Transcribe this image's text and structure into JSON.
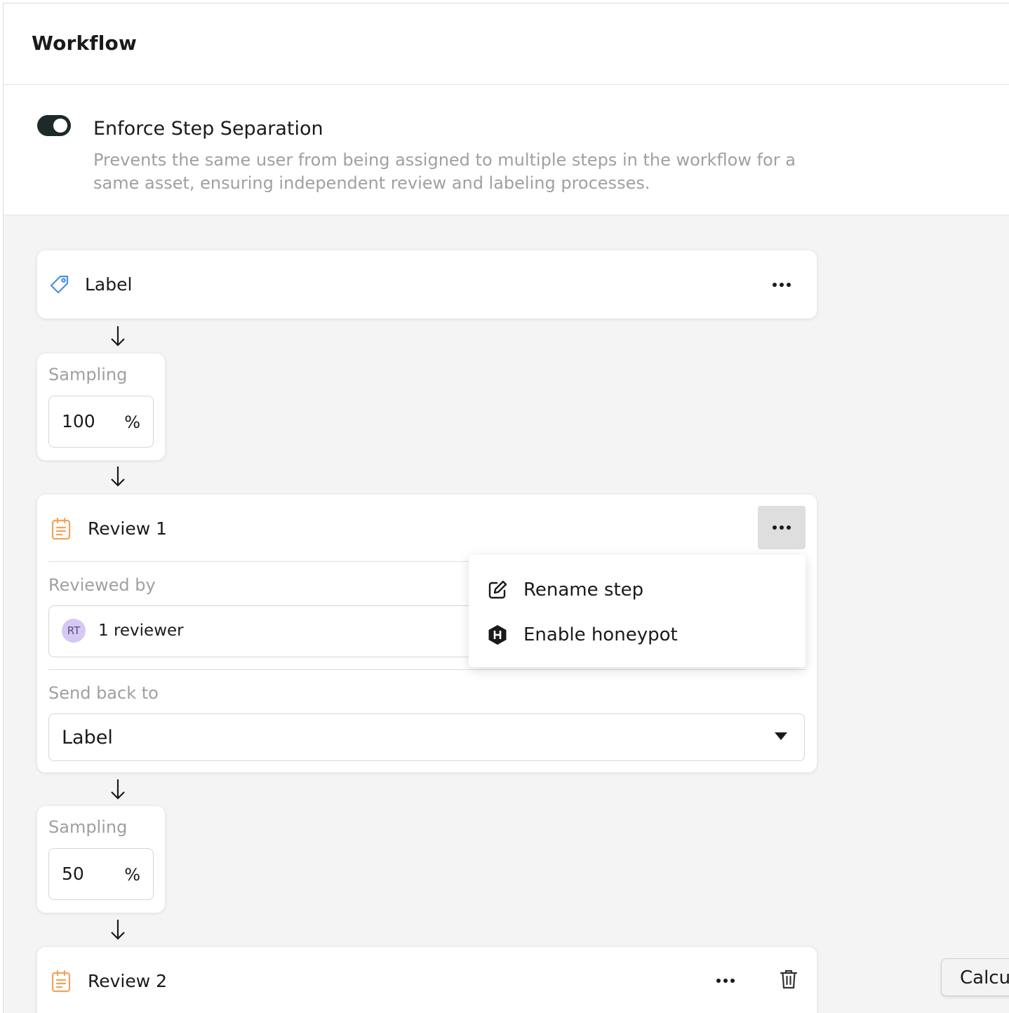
{
  "header": {
    "title": "Workflow"
  },
  "setting": {
    "enabled": true,
    "title": "Enforce Step Separation",
    "description": "Prevents the same user from being assigned to multiple steps in the workflow for a same asset, ensuring independent review and labeling processes."
  },
  "steps": {
    "label_step": {
      "title": "Label",
      "icon": "tag-icon"
    },
    "sampling_1": {
      "label": "Sampling",
      "value": "100",
      "unit": "%"
    },
    "review_1": {
      "title": "Review 1",
      "icon": "clipboard-icon",
      "reviewed_by_label": "Reviewed by",
      "reviewer_initials": "RT",
      "reviewer_summary": "1 reviewer",
      "send_back_label": "Send back to",
      "send_back_value": "Label"
    },
    "sampling_2": {
      "label": "Sampling",
      "value": "50",
      "unit": "%"
    },
    "review_2": {
      "title": "Review 2",
      "icon": "clipboard-icon"
    }
  },
  "context_menu": {
    "items": [
      {
        "label": "Rename step",
        "icon": "edit-icon"
      },
      {
        "label": "Enable honeypot",
        "icon": "honeypot-icon"
      }
    ]
  },
  "tooltip": {
    "text": "Calcu"
  },
  "colors": {
    "accent_blue": "#4a90e2",
    "review_orange": "#f0a45a",
    "toggle_on": "#1e2a2a",
    "canvas_bg": "#f4f4f4"
  }
}
